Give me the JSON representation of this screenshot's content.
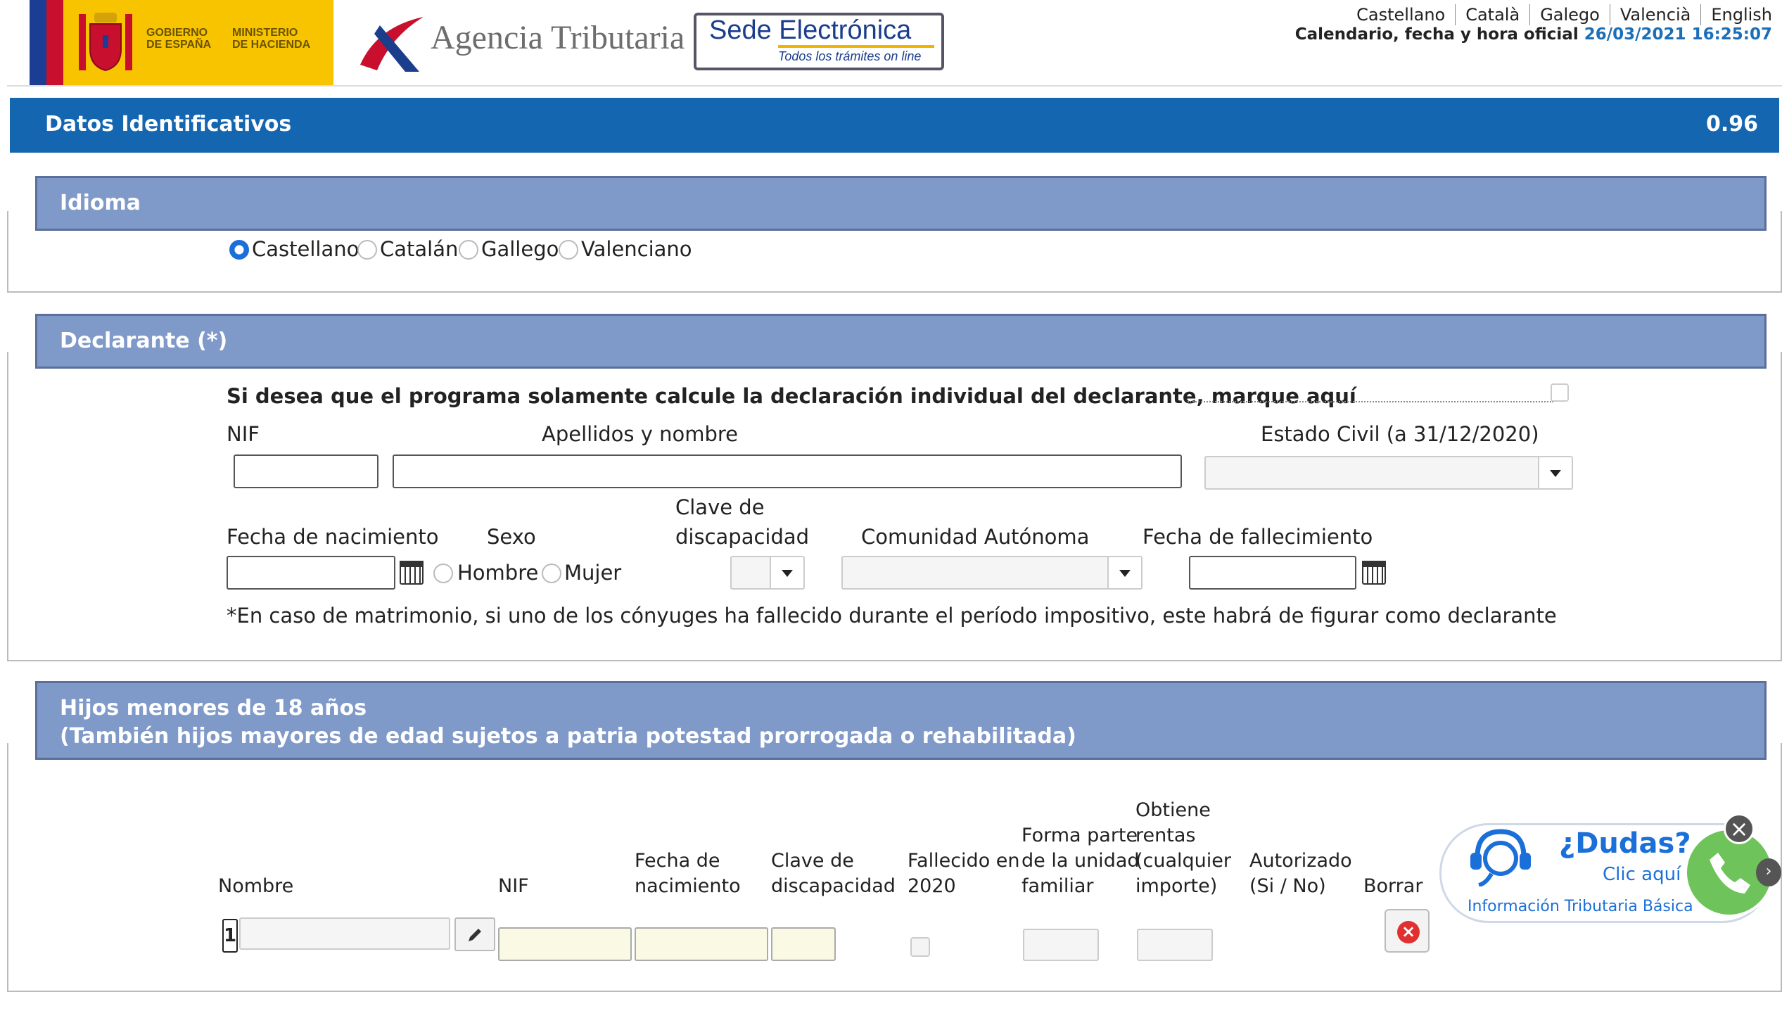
{
  "header": {
    "gov_line1": "GOBIERNO",
    "gov_line2": "DE ESPAÑA",
    "min_line1": "MINISTERIO",
    "min_line2": "DE HACIENDA",
    "agency": "Agencia Tributaria",
    "sede_title": "Sede Electrónica",
    "sede_sub": "Todos los trámites on line",
    "languages": [
      "Castellano",
      "Català",
      "Galego",
      "Valencià",
      "English"
    ],
    "calendar_label": "Calendario, fecha y hora oficial",
    "datetime": "26/03/2021 16:25:07"
  },
  "main_bar": {
    "title": "Datos Identificativos",
    "version": "0.96"
  },
  "idioma": {
    "title": "Idioma",
    "options": [
      "Castellano",
      "Catalán",
      "Gallego",
      "Valenciano"
    ],
    "selected": "Castellano"
  },
  "declarante": {
    "title": "Declarante (*)",
    "individual_text": "Si desea que el programa solamente calcule la declaración individual del declarante, marque aquí",
    "nif_label": "NIF",
    "nombre_label": "Apellidos y nombre",
    "estado_civil_label": "Estado Civil (a 31/12/2020)",
    "fecha_nac_label": "Fecha de nacimiento",
    "sexo_label": "Sexo",
    "sexo_options": [
      "Hombre",
      "Mujer"
    ],
    "clave_disc_label_1": "Clave de",
    "clave_disc_label_2": "discapacidad",
    "comunidad_label": "Comunidad Autónoma",
    "fecha_fall_label": "Fecha de fallecimiento",
    "note": "*En caso de matrimonio, si uno de los cónyuges ha fallecido durante el período impositivo, este habrá de figurar como declarante"
  },
  "hijos": {
    "title_1": "Hijos menores de 18 años",
    "title_2": "(También hijos mayores de edad sujetos a patria potestad prorrogada o rehabilitada)",
    "col_nombre": "Nombre",
    "col_nif": "NIF",
    "col_fecha_1": "Fecha de",
    "col_fecha_2": "nacimiento",
    "col_clave_1": "Clave de",
    "col_clave_2": "discapacidad",
    "col_fall_1": "Fallecido en",
    "col_fall_2": "2020",
    "col_forma_1": "Forma parte",
    "col_forma_2": "de la unidad",
    "col_forma_3": "familiar",
    "col_obt_1": "Obtiene",
    "col_obt_2": "rentas",
    "col_obt_3": "(cualquier",
    "col_obt_4": "importe)",
    "col_aut_1": "Autorizado",
    "col_aut_2": "(Si / No)",
    "col_borrar": "Borrar",
    "row_number": "1"
  },
  "dudas": {
    "title": "¿Dudas?",
    "cta": "Clic aquí",
    "subtitle": "Información Tributaria Básica"
  },
  "colors": {
    "main_bar": "#1466b0",
    "section_head": "#7f99c8",
    "accent": "#1b6fb8"
  }
}
